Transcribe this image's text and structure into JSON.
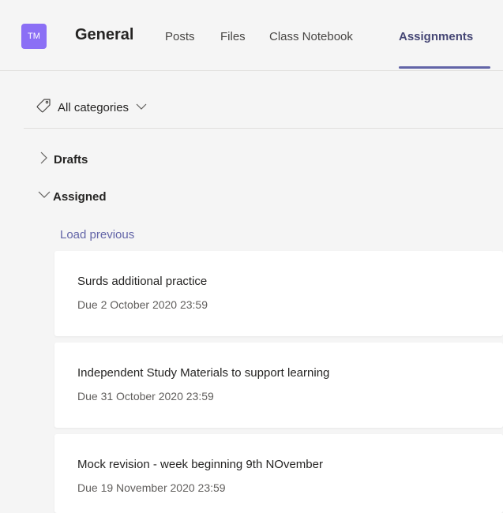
{
  "header": {
    "avatar_initials": "TM",
    "team_name": "General",
    "tabs": [
      {
        "label": "Posts"
      },
      {
        "label": "Files"
      },
      {
        "label": "Class Notebook"
      },
      {
        "label": "Assignments",
        "active": true
      }
    ]
  },
  "filter": {
    "label": "All categories",
    "icon": "tag-icon"
  },
  "sections": {
    "drafts": {
      "label": "Drafts",
      "expanded": false
    },
    "assigned": {
      "label": "Assigned",
      "expanded": true
    }
  },
  "load_previous": "Load previous",
  "assignments": [
    {
      "title": "Surds additional practice",
      "due": "Due 2 October 2020 23:59"
    },
    {
      "title": "Independent Study Materials to support learning",
      "due": "Due 31 October 2020 23:59"
    },
    {
      "title": "Mock revision - week beginning 9th NOvember",
      "due": "Due 19 November 2020 23:59"
    }
  ],
  "colors": {
    "accent": "#6264a7",
    "avatar": "#8b6ff5",
    "background": "#f5f5f5"
  }
}
